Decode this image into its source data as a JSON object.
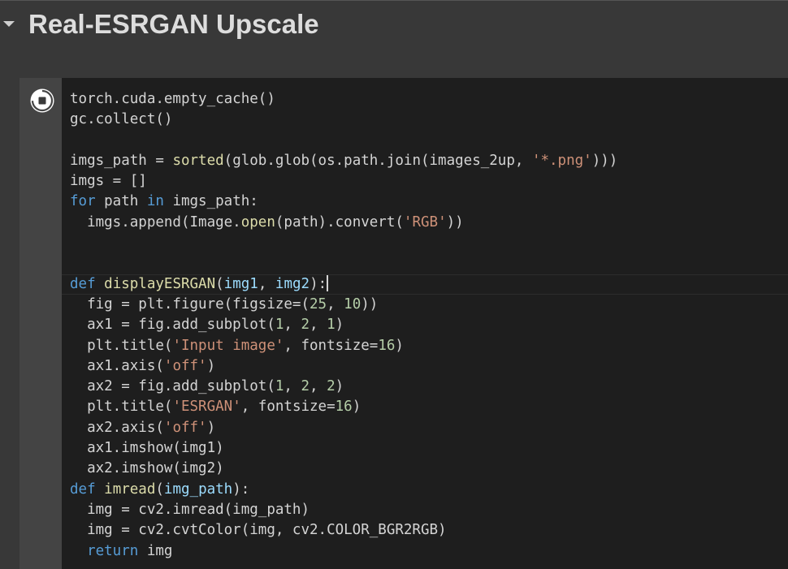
{
  "section": {
    "title": "Real-ESRGAN Upscale",
    "collapse_icon": "caret-down-icon"
  },
  "cell": {
    "run_icon": "stop-circle-icon",
    "lines": [
      [
        {
          "t": "torch.cuda.empty_cache()",
          "c": "plain"
        }
      ],
      [
        {
          "t": "gc.collect()",
          "c": "plain"
        }
      ],
      [],
      [
        {
          "t": "imgs_path = ",
          "c": "plain"
        },
        {
          "t": "sorted",
          "c": "fn"
        },
        {
          "t": "(glob.glob(os.path.join(images_2up, ",
          "c": "plain"
        },
        {
          "t": "'*.png'",
          "c": "str"
        },
        {
          "t": ")))",
          "c": "plain"
        }
      ],
      [
        {
          "t": "imgs = []",
          "c": "plain"
        }
      ],
      [
        {
          "t": "for",
          "c": "kw"
        },
        {
          "t": " path ",
          "c": "plain"
        },
        {
          "t": "in",
          "c": "kw"
        },
        {
          "t": " imgs_path:",
          "c": "plain"
        }
      ],
      [
        {
          "t": "  imgs.append(Image.",
          "c": "plain"
        },
        {
          "t": "open",
          "c": "fn"
        },
        {
          "t": "(path).convert(",
          "c": "plain"
        },
        {
          "t": "'RGB'",
          "c": "str"
        },
        {
          "t": "))",
          "c": "plain"
        }
      ],
      [],
      [],
      [
        {
          "t": "def",
          "c": "kw"
        },
        {
          "t": " ",
          "c": "plain"
        },
        {
          "t": "displayESRGAN",
          "c": "fn"
        },
        {
          "t": "(",
          "c": "plain"
        },
        {
          "t": "img1",
          "c": "var"
        },
        {
          "t": ", ",
          "c": "plain"
        },
        {
          "t": "img2",
          "c": "var"
        },
        {
          "t": "):",
          "c": "plain"
        }
      ],
      [
        {
          "t": "  fig = plt.figure(figsize=(",
          "c": "plain"
        },
        {
          "t": "25",
          "c": "num"
        },
        {
          "t": ", ",
          "c": "plain"
        },
        {
          "t": "10",
          "c": "num"
        },
        {
          "t": "))",
          "c": "plain"
        }
      ],
      [
        {
          "t": "  ax1 = fig.add_subplot(",
          "c": "plain"
        },
        {
          "t": "1",
          "c": "num"
        },
        {
          "t": ", ",
          "c": "plain"
        },
        {
          "t": "2",
          "c": "num"
        },
        {
          "t": ", ",
          "c": "plain"
        },
        {
          "t": "1",
          "c": "num"
        },
        {
          "t": ")",
          "c": "plain"
        }
      ],
      [
        {
          "t": "  plt.title(",
          "c": "plain"
        },
        {
          "t": "'Input image'",
          "c": "str"
        },
        {
          "t": ", fontsize=",
          "c": "plain"
        },
        {
          "t": "16",
          "c": "num"
        },
        {
          "t": ")",
          "c": "plain"
        }
      ],
      [
        {
          "t": "  ax1.axis(",
          "c": "plain"
        },
        {
          "t": "'off'",
          "c": "str"
        },
        {
          "t": ")",
          "c": "plain"
        }
      ],
      [
        {
          "t": "  ax2 = fig.add_subplot(",
          "c": "plain"
        },
        {
          "t": "1",
          "c": "num"
        },
        {
          "t": ", ",
          "c": "plain"
        },
        {
          "t": "2",
          "c": "num"
        },
        {
          "t": ", ",
          "c": "plain"
        },
        {
          "t": "2",
          "c": "num"
        },
        {
          "t": ")",
          "c": "plain"
        }
      ],
      [
        {
          "t": "  plt.title(",
          "c": "plain"
        },
        {
          "t": "'ESRGAN'",
          "c": "str"
        },
        {
          "t": ", fontsize=",
          "c": "plain"
        },
        {
          "t": "16",
          "c": "num"
        },
        {
          "t": ")",
          "c": "plain"
        }
      ],
      [
        {
          "t": "  ax2.axis(",
          "c": "plain"
        },
        {
          "t": "'off'",
          "c": "str"
        },
        {
          "t": ")",
          "c": "plain"
        }
      ],
      [
        {
          "t": "  ax1.imshow(img1)",
          "c": "plain"
        }
      ],
      [
        {
          "t": "  ax2.imshow(img2)",
          "c": "plain"
        }
      ],
      [
        {
          "t": "def",
          "c": "kw"
        },
        {
          "t": " ",
          "c": "plain"
        },
        {
          "t": "imread",
          "c": "fn"
        },
        {
          "t": "(",
          "c": "plain"
        },
        {
          "t": "img_path",
          "c": "var"
        },
        {
          "t": "):",
          "c": "plain"
        }
      ],
      [
        {
          "t": "  img = cv2.imread(img_path)",
          "c": "plain"
        }
      ],
      [
        {
          "t": "  img = cv2.cvtColor(img, cv2.COLOR_BGR2RGB)",
          "c": "plain"
        }
      ],
      [
        {
          "t": "  ",
          "c": "plain"
        },
        {
          "t": "return",
          "c": "kw"
        },
        {
          "t": " img",
          "c": "plain"
        }
      ]
    ],
    "cursor_line": 9
  },
  "colors": {
    "keyword": "#569cd6",
    "function": "#dcdcaa",
    "string": "#ce9178",
    "number": "#b5cea8",
    "parameter": "#9cdcfe",
    "text": "#d4d4d4",
    "editor_bg": "#1e1e1e",
    "page_bg": "#383838"
  }
}
